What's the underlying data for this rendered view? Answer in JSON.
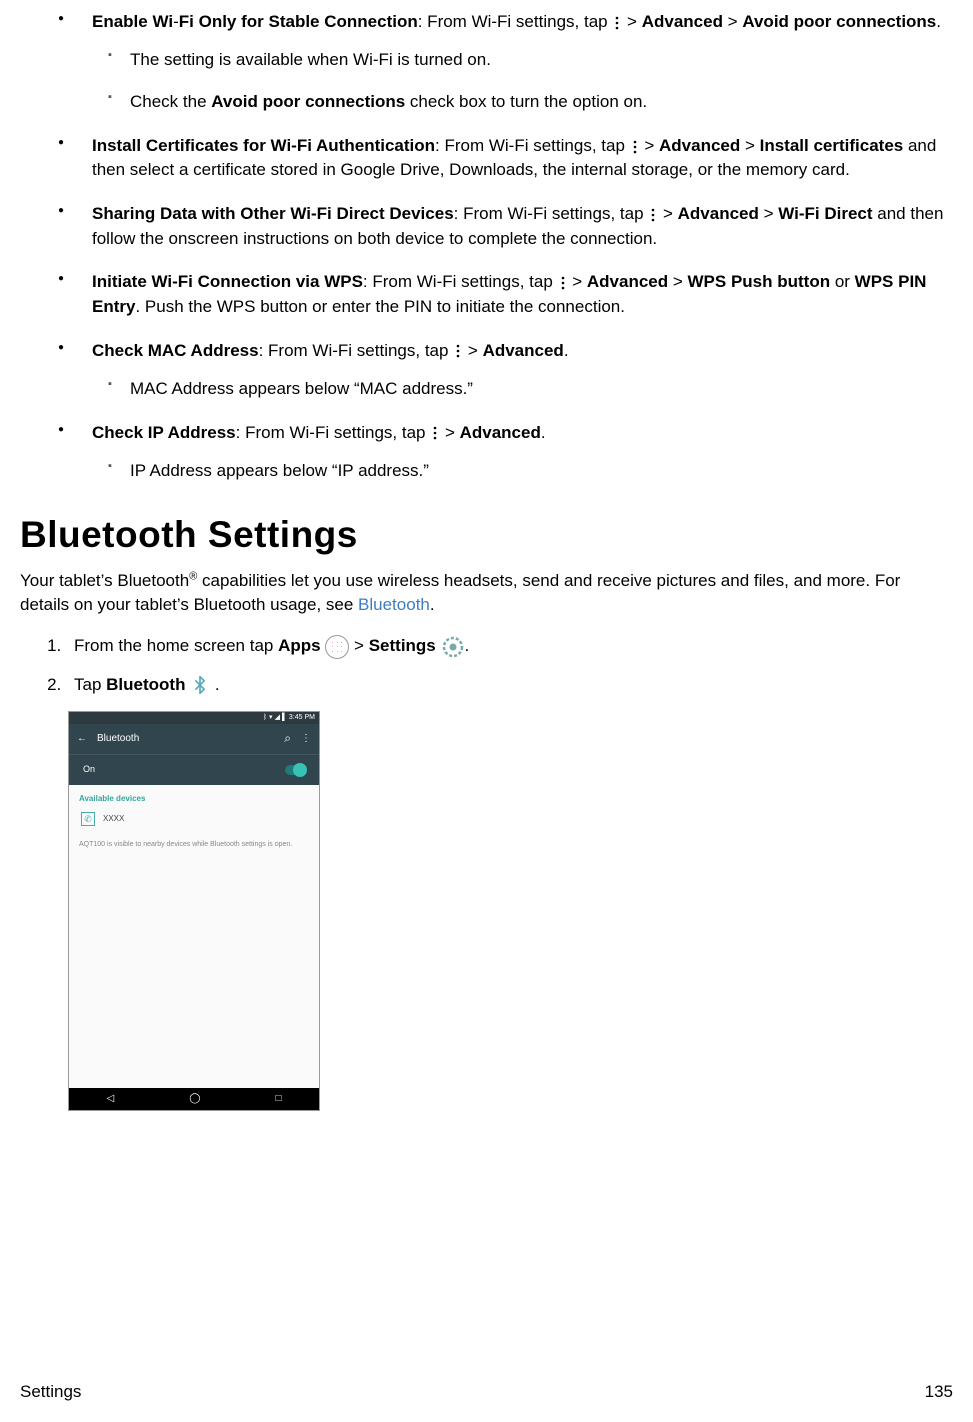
{
  "items": [
    {
      "title": "Enable Wi",
      "dash": "-",
      "title2": "Fi Only for Stable Connection",
      "pre": ": From Wi-Fi settings, tap ",
      "seq": [
        " > ",
        "Advanced",
        " > ",
        "Avoid poor connections",
        "."
      ],
      "subs": [
        "The setting is available when Wi-Fi is turned on.",
        {
          "pre": "Check the ",
          "b": "Avoid poor connections",
          "post": " check box to turn the option on."
        }
      ]
    },
    {
      "title": "Install Certificates for Wi-Fi Authentication",
      "pre": ": From Wi-Fi settings, tap ",
      "seq": [
        " > ",
        "Advanced",
        " > ",
        "Install certificates",
        " and then select a certificate stored in Google Drive, Downloads, the internal storage, or the memory card."
      ]
    },
    {
      "title": "Sharing Data with Other Wi-Fi Direct Devices",
      "pre": ": From Wi-Fi settings, tap ",
      "seq": [
        " > ",
        "Advanced",
        " > ",
        "Wi-Fi Direct",
        " and then follow the onscreen instructions on both device to complete the connection."
      ]
    },
    {
      "title": "Initiate Wi-Fi Connection via WPS",
      "pre": ": From Wi-Fi settings, tap ",
      "seq": [
        " > ",
        "Advanced",
        " > ",
        "WPS Push button",
        " or ",
        "WPS PIN Entry",
        ". Push the WPS button or enter the PIN to initiate the connection."
      ]
    },
    {
      "title": "Check MAC Address",
      "pre": ": From Wi-Fi settings, tap ",
      "seq": [
        " > ",
        "Advanced",
        "."
      ],
      "subs": [
        "MAC Address appears below “MAC address.”"
      ]
    },
    {
      "title": "Check IP Address",
      "pre": ": From Wi-Fi settings, tap ",
      "seq": [
        " > ",
        "Advanced",
        "."
      ],
      "subs": [
        "IP Address appears below “IP address.”"
      ]
    }
  ],
  "heading": "Bluetooth Settings",
  "intro": {
    "p1": "Your tablet’s Bluetooth",
    "sup": "®",
    "p2": " capabilities let you use wireless headsets, send and receive pictures and files, and more. For details on your tablet’s Bluetooth usage, see ",
    "link": "Bluetooth",
    "p3": "."
  },
  "steps": {
    "s1a": "From the home screen tap ",
    "s1b": "Apps",
    "s1c": " > ",
    "s1d": "Settings",
    "s1e": ".",
    "s2a": "Tap ",
    "s2b": "Bluetooth",
    "s2c": " ."
  },
  "screenshot": {
    "status_time": "3:45 PM",
    "back": "←",
    "title": "Bluetooth",
    "on": "On",
    "avail": "Available devices",
    "dev": "XXXX",
    "note": "AQT100 is visible to nearby devices while Bluetooth settings is open."
  },
  "footer": {
    "left": "Settings",
    "right": "135"
  }
}
